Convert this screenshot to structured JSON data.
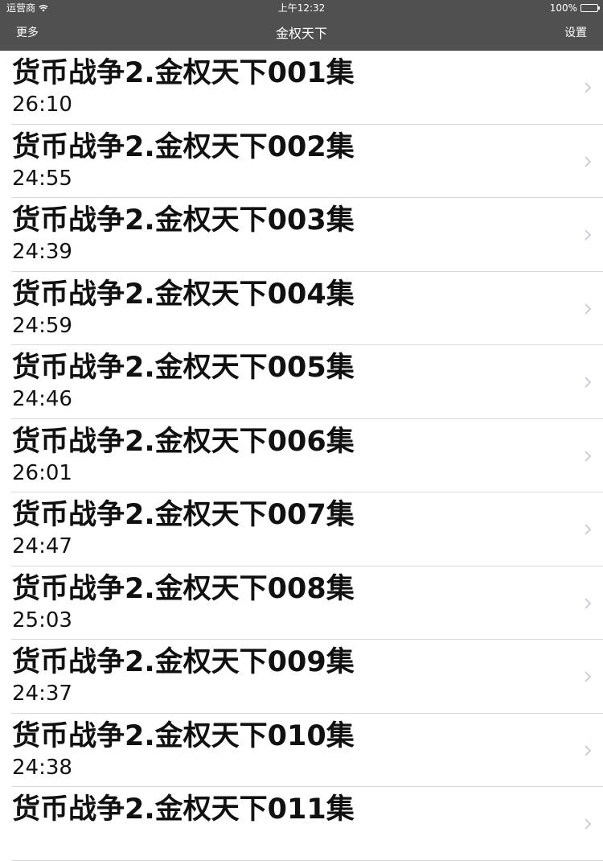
{
  "status_bar": {
    "carrier": "运营商",
    "time": "上午12:32",
    "battery": "100%"
  },
  "nav": {
    "left_label": "更多",
    "title": "金权天下",
    "right_label": "设置"
  },
  "episodes": [
    {
      "title": "货币战争2.金权天下001集",
      "duration": "26:10"
    },
    {
      "title": "货币战争2.金权天下002集",
      "duration": "24:55"
    },
    {
      "title": "货币战争2.金权天下003集",
      "duration": "24:39"
    },
    {
      "title": "货币战争2.金权天下004集",
      "duration": "24:59"
    },
    {
      "title": "货币战争2.金权天下005集",
      "duration": "24:46"
    },
    {
      "title": "货币战争2.金权天下006集",
      "duration": "26:01"
    },
    {
      "title": "货币战争2.金权天下007集",
      "duration": "24:47"
    },
    {
      "title": "货币战争2.金权天下008集",
      "duration": "25:03"
    },
    {
      "title": "货币战争2.金权天下009集",
      "duration": "24:37"
    },
    {
      "title": "货币战争2.金权天下010集",
      "duration": "24:38"
    },
    {
      "title": "货币战争2.金权天下011集",
      "duration": ""
    }
  ],
  "colors": {
    "bar_background": "#505050",
    "separator": "#d9d9d9",
    "chevron": "#c7c7cc"
  },
  "icons": {
    "wifi": "wifi-icon",
    "battery": "battery-icon",
    "disclosure": "chevron-right-icon"
  }
}
